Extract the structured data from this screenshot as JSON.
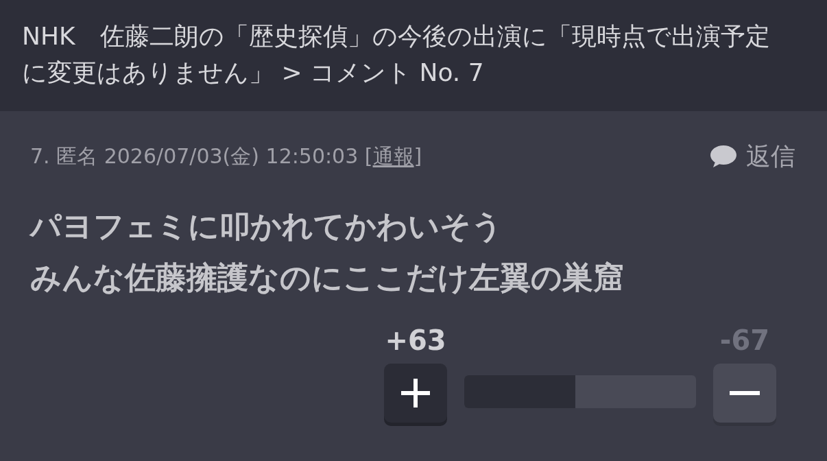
{
  "header": {
    "title": "NHK　佐藤二朗の「歴史探偵」の今後の出演に「現時点で出演予定に変更はありません」",
    "separator": ">",
    "breadcrumb": "コメント No. 7"
  },
  "comment": {
    "number": "7.",
    "author": "匿名",
    "posted_at": "2026/07/03(金) 12:50:03",
    "report_link": {
      "open": "[",
      "label": "通報",
      "close": "]"
    },
    "reply_button": "返信",
    "body_lines": [
      "パヨフェミに叩かれてかわいそう",
      "みんな佐藤擁護なのにここだけ左翼の巣窟"
    ],
    "votes": {
      "buttons": [
        {
          "kind": "up",
          "count": "+63",
          "selected": true
        },
        {
          "kind": "down",
          "count": "-67",
          "selected": false
        }
      ],
      "level": 0.48
    }
  }
}
